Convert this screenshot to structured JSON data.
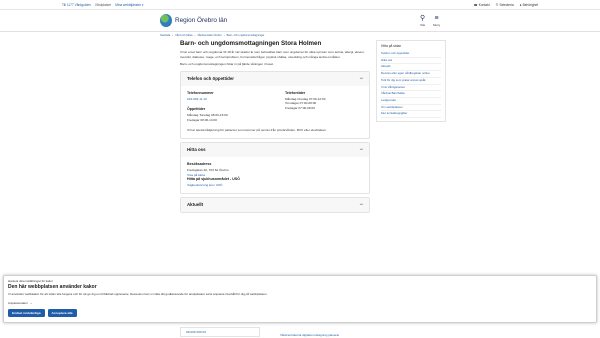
{
  "topbar": {
    "left": [
      "Till 1177 Vårdguiden",
      "Vårdplatser",
      "Mina webbtjänster ▾"
    ],
    "right": [
      "Kontakt",
      "Selecteria",
      "Behörighet"
    ]
  },
  "header": {
    "logo_text": "Region Örebro län",
    "search_label": "Sök",
    "menu_label": "Meny"
  },
  "breadcrumb": [
    "Startsida",
    "Vård och hälsa",
    "Vårdcentraler Örebro",
    "Barn- och ungdomsmottagningar"
  ],
  "main": {
    "title": "Barn- och ungdomsmottagningen Stora Holmen",
    "intro": "Vi tar emot barn och ungdomar till 18 år när skador är som behandlas barn som ungdomar för olika symtom som astma, allergi, eksem, övervikt, diabetes, mage- och tarmproblem, hormonella frågor, psykisk ohälsa, utveckling och många andra områden.",
    "intro2": "Barn- och ungdomsmottagningen hittar ni på fjärde våningen i huset.",
    "sections": [
      {
        "title": "Telefon och öppettider",
        "phone_head": "Telefonnummer",
        "phone": "019-602 11 10",
        "phone_hours_head": "Telefontider",
        "phone_hours": [
          "Måndag-Onsdag 07:00-12:00",
          "Torsdagar 07:00-08:00",
          "Fredagar 07:00-08:00"
        ],
        "open_head": "Öppettider",
        "open": [
          "Måndag-Torsdag 08:00-16:00",
          "Fredagar 08:00-14:00"
        ],
        "note": "Vi har telefonrådgivning för patienter som kommer på remiss från primärvården. BVC eller elevhälsan."
      },
      {
        "title": "Hitta oss",
        "visit_head": "Besöksadress",
        "visit": "Fredsgatan 40, 703 62 Örebro",
        "visit_link": "Visa på karta",
        "hospital_head": "Hitta på sjukhusområdet - USÖ",
        "hospital_link": "Vägbeskrivning kom USÖ"
      },
      {
        "title": "Aktuellt"
      }
    ]
  },
  "sidebar": {
    "title": "Hitta på sidan",
    "items": [
      "Telefon och öppettider",
      "Hitta oss",
      "Aktuellt",
      "Remiss eller egen vårdbegäran online",
      "Tolk för dig som pratar annat språk",
      "Vi är Vårdgaranten",
      "Vårdval Barnhälsa",
      "Lediga tider",
      "Om webbplatsen",
      "Fler kontaktuppgifter"
    ]
  },
  "bottom": {
    "phone": "08-000 000 00",
    "link": "Vårdcentralerna digitala mottagning planerat"
  },
  "cookie": {
    "top_link": "Hantera dina inställningar för kakor",
    "heading": "Den här webbplatsen använder kakor",
    "description": "Vi använder webbkakor för att sidan ska fungera och för att ge dig en förbättrad upplevelse. Dessutom kan vi mäta ditt godkännande för analyskakor samt anpassa innehåll för dig på webbplatsen.",
    "toggle_label": "Anpassa kakor",
    "btn_necessary": "Endast nödvändiga",
    "btn_accept": "Acceptera alla"
  }
}
